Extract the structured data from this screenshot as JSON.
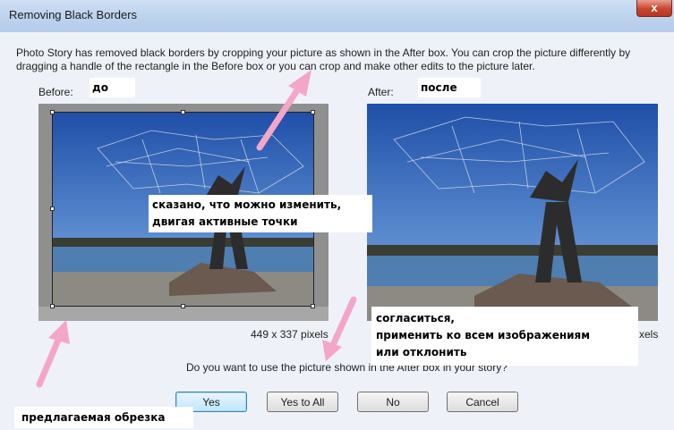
{
  "window": {
    "title": "Removing Black Borders",
    "close_label": "x"
  },
  "description": "Photo Story has removed black borders by cropping your picture as shown in the After box. You can crop the picture differently by dragging a handle of the rectangle in the Before box or you can crop and make other edits to the picture later.",
  "before": {
    "label": "Before:",
    "size": "449 x 337 pixels"
  },
  "after": {
    "label": "After:",
    "size_fragment": "xels"
  },
  "question": "Do you want to use the picture shown in the After box in your story?",
  "buttons": {
    "yes": "Yes",
    "yes_to_all": "Yes to All",
    "no": "No",
    "cancel": "Cancel"
  },
  "annotations": {
    "before_ru": "до",
    "after_ru": "после",
    "handles_note_line1": "сказано, что можно изменить,",
    "handles_note_line2": "двигая активные точки",
    "choice_line1": "согласиться,",
    "choice_line2": "применить ко всем изображениям",
    "choice_line3": "или отклонить",
    "crop_note": "предлагаемая обрезка"
  },
  "colors": {
    "annotation_arrow": "#f4a6c8",
    "dialog_background": "#eef2f8",
    "close_button": "#c8452e"
  }
}
